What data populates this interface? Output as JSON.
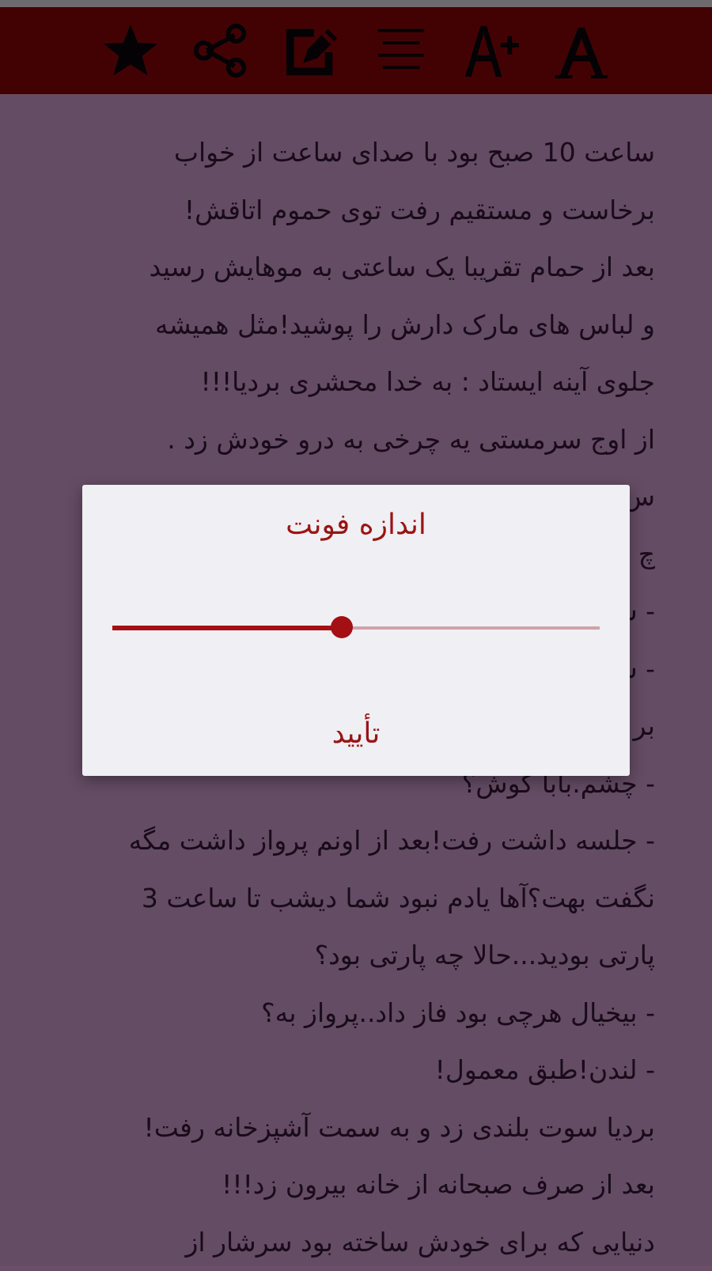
{
  "toolbar": {
    "icons": [
      "star-icon",
      "share-icon",
      "edit-note-icon",
      "text-align-icon",
      "font-size-increase-icon",
      "font-style-icon"
    ]
  },
  "reader": {
    "lines": [
      "ساعت 10 صبح بود با صدای ساعت از خواب",
      "برخاست و مستقیم رفت توی حموم اتاقش!",
      "بعد از حمام تقریبا یک ساعتی به موهایش رسید",
      "و لباس های مارک دارش را پوشید!مثل همیشه",
      "جلوی آینه ایستاد : به خدا محشری بردیا!!!",
      "از اوج سرمستی یه چرخی به درو خودش زد .",
      "س",
      "چ",
      "- س",
      "- س",
      "بر",
      "- چشم.بابا کوش؟",
      "- جلسه داشت رفت!بعد از اونم پرواز داشت مگه",
      "نگفت بهت؟آها یادم نبود شما دیشب تا ساعت 3",
      "پارتی بودید...حالا چه پارتی بود؟",
      "- بیخیال هرچی بود فاز داد..پرواز به؟",
      "- لندن!طبق معمول!",
      "بردیا سوت بلندی زد و به سمت آشپزخانه رفت!",
      "بعد از صرف صبحانه از خانه بیرون زد!!!",
      "دنیایی که برای خودش ساخته بود سرشار از"
    ]
  },
  "dialog": {
    "title": "اندازه فونت",
    "slider_value_fraction": 0.47,
    "confirm_label": "تأیید"
  },
  "colors": {
    "toolbar_bg": "#420000",
    "page_bg": "#664e66",
    "accent": "#a30f12",
    "dialog_bg": "#f0eff4"
  }
}
